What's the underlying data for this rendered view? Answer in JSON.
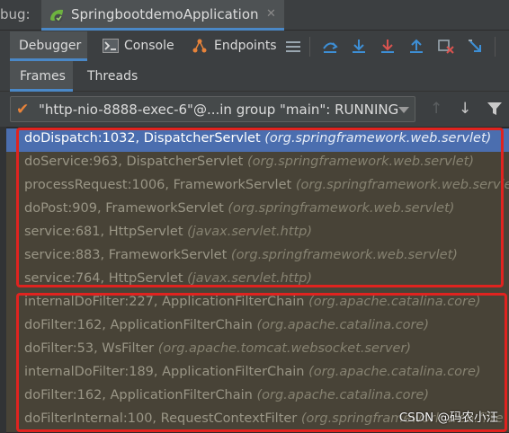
{
  "window": {
    "panel_label": "bug:",
    "run_tab_title": "SpringbootdemoApplication",
    "run_tab_close": "✕"
  },
  "toolbar": {
    "tabs": [
      {
        "label": "Debugger",
        "active": true
      },
      {
        "label": "Console",
        "active": false
      },
      {
        "label": "Endpoints",
        "active": false
      }
    ],
    "icons": [
      "menu-icon",
      "show-execution-point-icon",
      "step-over-icon",
      "step-into-icon",
      "step-out-icon",
      "drop-frame-icon",
      "run-to-cursor-icon"
    ]
  },
  "subtabs": [
    {
      "label": "Frames",
      "active": true
    },
    {
      "label": "Threads",
      "active": false
    }
  ],
  "thread_selector": {
    "value": "\"http-nio-8888-exec-6\"@...in group \"main\": RUNNING",
    "status_color": "#e8833a"
  },
  "frames": [
    {
      "method": "doDispatch:1032, DispatcherServlet",
      "package": "(org.springframework.web.servlet)",
      "selected": true,
      "library": false
    },
    {
      "method": "doService:963, DispatcherServlet",
      "package": "(org.springframework.web.servlet)",
      "selected": false,
      "library": true
    },
    {
      "method": "processRequest:1006, FrameworkServlet",
      "package": "(org.springframework.web.servle",
      "selected": false,
      "library": true
    },
    {
      "method": "doPost:909, FrameworkServlet",
      "package": "(org.springframework.web.servlet)",
      "selected": false,
      "library": true
    },
    {
      "method": "service:681, HttpServlet",
      "package": "(javax.servlet.http)",
      "selected": false,
      "library": true
    },
    {
      "method": "service:883, FrameworkServlet",
      "package": "(org.springframework.web.servlet)",
      "selected": false,
      "library": true
    },
    {
      "method": "service:764, HttpServlet",
      "package": "(javax.servlet.http)",
      "selected": false,
      "library": true
    },
    {
      "method": "internalDoFilter:227, ApplicationFilterChain",
      "package": "(org.apache.catalina.core)",
      "selected": false,
      "library": true
    },
    {
      "method": "doFilter:162, ApplicationFilterChain",
      "package": "(org.apache.catalina.core)",
      "selected": false,
      "library": true
    },
    {
      "method": "doFilter:53, WsFilter",
      "package": "(org.apache.tomcat.websocket.server)",
      "selected": false,
      "library": true
    },
    {
      "method": "internalDoFilter:189, ApplicationFilterChain",
      "package": "(org.apache.catalina.core)",
      "selected": false,
      "library": true
    },
    {
      "method": "doFilter:162, ApplicationFilterChain",
      "package": "(org.apache.catalina.core)",
      "selected": false,
      "library": true
    },
    {
      "method": "doFilterInternal:100, RequestContextFilter",
      "package": "(org.springframework.web.filte",
      "selected": false,
      "library": true
    }
  ],
  "watermark": "CSDN @码农小汪",
  "colors": {
    "accent": "#4a88c7",
    "selection": "#4b6eaf",
    "annotation_red": "#e0231f",
    "step_blue": "#3d8fd6",
    "step_red": "#d9534f"
  }
}
